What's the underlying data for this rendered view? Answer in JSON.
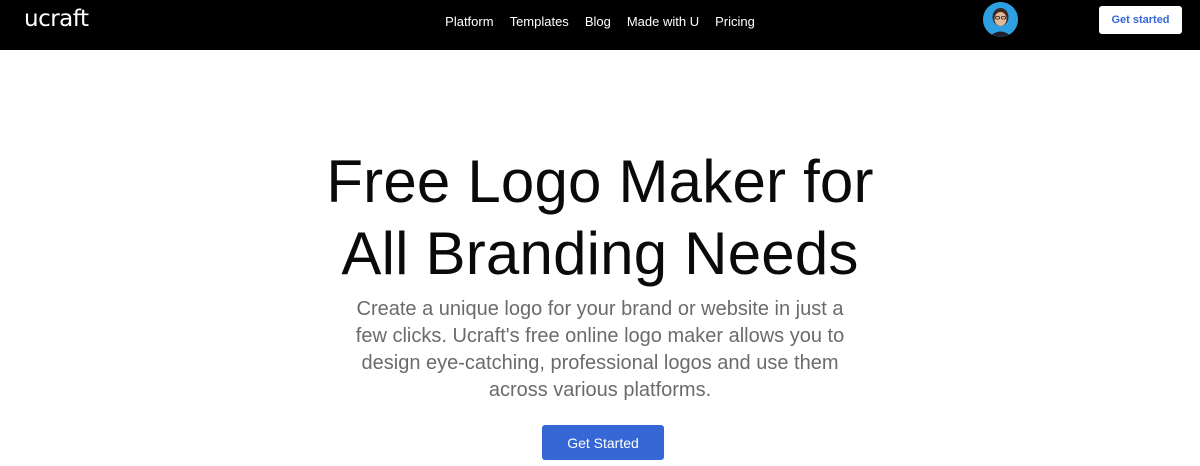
{
  "header": {
    "logo": "ucraft",
    "nav": [
      "Platform",
      "Templates",
      "Blog",
      "Made with U",
      "Pricing"
    ],
    "cta_label": "Get started",
    "colors": {
      "background": "#000000",
      "cta_text": "#3568d4"
    }
  },
  "hero": {
    "title_lines": [
      "Free Logo Maker for",
      "All Branding Needs"
    ],
    "subtitle_lines": [
      "Create a unique logo for your brand or website in just a",
      "few clicks. Ucraft's free online logo maker allows you to",
      "design eye-catching, professional logos and use them",
      "across various platforms."
    ],
    "cta_label": "Get Started",
    "colors": {
      "cta_background": "#3568d4",
      "subtitle": "#6b6b6b"
    }
  }
}
